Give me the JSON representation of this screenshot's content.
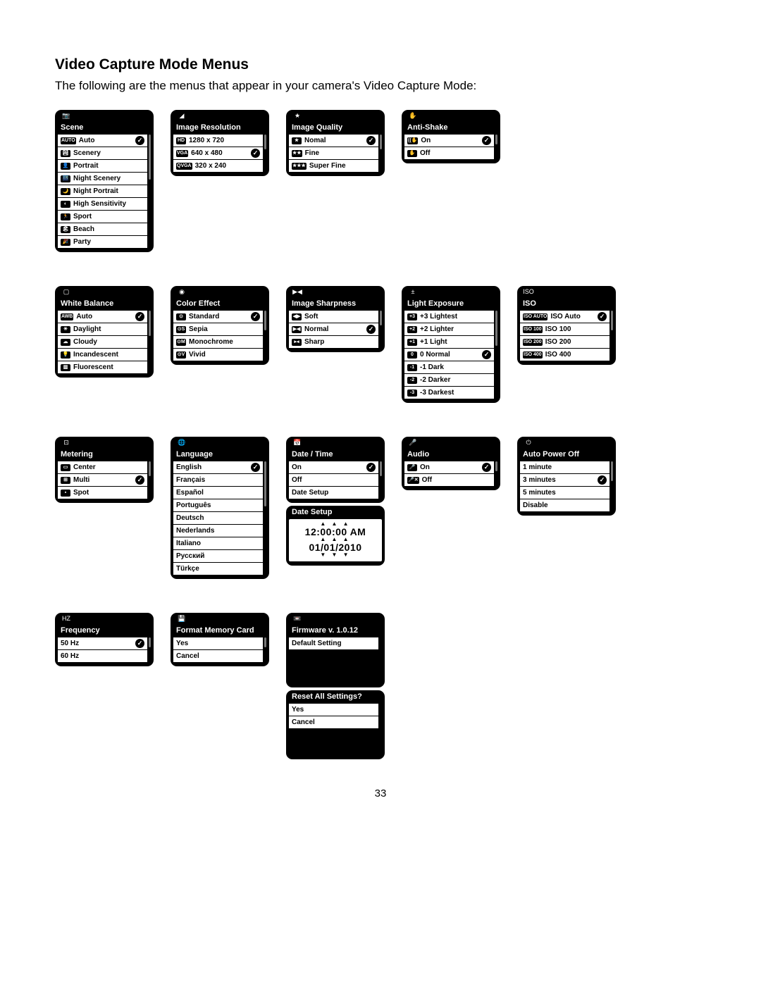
{
  "page": {
    "title": "Video Capture Mode Menus",
    "intro": "The following are the menus that appear in your camera's Video Capture Mode:",
    "page_number": "33"
  },
  "menus": {
    "scene": {
      "tab_icon": "📷",
      "title": "Scene",
      "items": [
        {
          "icon_text": "AUTO",
          "label": "Auto",
          "selected": true
        },
        {
          "icon_text": "🏞",
          "label": "Scenery"
        },
        {
          "icon_text": "👤",
          "label": "Portrait"
        },
        {
          "icon_text": "🌃",
          "label": "Night Scenery"
        },
        {
          "icon_text": "🌙",
          "label": "Night Portrait"
        },
        {
          "icon_text": "◐",
          "label": "High Sensitivity"
        },
        {
          "icon_text": "🏃",
          "label": "Sport"
        },
        {
          "icon_text": "🏖",
          "label": "Beach"
        },
        {
          "icon_text": "🎉",
          "label": "Party"
        }
      ]
    },
    "image_resolution": {
      "tab_icon": "◢",
      "title": "Image Resolution",
      "items": [
        {
          "icon_text": "HD",
          "label": "1280 x 720"
        },
        {
          "icon_text": "VGA",
          "label": "640 x 480",
          "selected": true
        },
        {
          "icon_text": "QVGA",
          "label": "320 x 240"
        }
      ]
    },
    "image_quality": {
      "tab_icon": "★",
      "title": "Image Quality",
      "items": [
        {
          "icon_text": "★",
          "label": "Nomal",
          "selected": true
        },
        {
          "icon_text": "★★",
          "label": "Fine"
        },
        {
          "icon_text": "★★★",
          "label": "Super Fine"
        }
      ]
    },
    "anti_shake": {
      "tab_icon": "✋",
      "title": "Anti-Shake",
      "items": [
        {
          "icon_text": "((✋",
          "label": "On",
          "selected": true
        },
        {
          "icon_text": "✋",
          "label": "Off"
        }
      ]
    },
    "white_balance": {
      "tab_icon": "▢",
      "title": "White Balance",
      "items": [
        {
          "icon_text": "AWB",
          "label": "Auto",
          "selected": true
        },
        {
          "icon_text": "☀",
          "label": "Daylight"
        },
        {
          "icon_text": "☁",
          "label": "Cloudy"
        },
        {
          "icon_text": "💡",
          "label": "Incandescent"
        },
        {
          "icon_text": "▥",
          "label": "Fluorescent"
        }
      ]
    },
    "color_effect": {
      "tab_icon": "◉",
      "title": "Color Effect",
      "items": [
        {
          "icon_text": "⊙",
          "label": "Standard",
          "selected": true
        },
        {
          "icon_text": "⊙S",
          "label": "Sepia"
        },
        {
          "icon_text": "⊙M",
          "label": "Monochrome"
        },
        {
          "icon_text": "⊙V",
          "label": "Vivid"
        }
      ]
    },
    "image_sharpness": {
      "tab_icon": "▶◀",
      "title": "Image Sharpness",
      "items": [
        {
          "icon_text": "◀▶",
          "label": "Soft"
        },
        {
          "icon_text": "▶◀",
          "label": "Normal",
          "selected": true
        },
        {
          "icon_text": "▸◂",
          "label": "Sharp"
        }
      ]
    },
    "light_exposure": {
      "tab_icon": "±",
      "title": "Light Exposure",
      "items": [
        {
          "icon_text": "+3",
          "label": "+3 Lightest"
        },
        {
          "icon_text": "+2",
          "label": "+2 Lighter"
        },
        {
          "icon_text": "+1",
          "label": "+1 Light"
        },
        {
          "icon_text": "0",
          "label": "0 Normal",
          "selected": true
        },
        {
          "icon_text": "-1",
          "label": "-1 Dark"
        },
        {
          "icon_text": "-2",
          "label": "-2 Darker"
        },
        {
          "icon_text": "-3",
          "label": "-3 Darkest"
        }
      ]
    },
    "iso": {
      "tab_icon": "ISO",
      "title": "ISO",
      "items": [
        {
          "icon_text": "ISO\nAUTO",
          "label": "ISO Auto",
          "selected": true
        },
        {
          "icon_text": "ISO\n100",
          "label": "ISO 100"
        },
        {
          "icon_text": "ISO\n200",
          "label": "ISO 200"
        },
        {
          "icon_text": "ISO\n400",
          "label": "ISO 400"
        }
      ]
    },
    "metering": {
      "tab_icon": "⊡",
      "title": "Metering",
      "items": [
        {
          "icon_text": "▭",
          "label": "Center"
        },
        {
          "icon_text": "⊞",
          "label": "Multi",
          "selected": true
        },
        {
          "icon_text": "▪",
          "label": "Spot"
        }
      ]
    },
    "language": {
      "tab_icon": "🌐",
      "title": "Language",
      "items": [
        {
          "label": "English",
          "selected": true
        },
        {
          "label": "Français"
        },
        {
          "label": "Español"
        },
        {
          "label": "Português"
        },
        {
          "label": "Deutsch"
        },
        {
          "label": "Nederlands"
        },
        {
          "label": "Italiano"
        },
        {
          "label": "Русский"
        },
        {
          "label": "Türkçe"
        }
      ]
    },
    "date_time": {
      "tab_icon": "📅",
      "title": "Date / Time",
      "items": [
        {
          "label": "On",
          "selected": true
        },
        {
          "label": "Off"
        },
        {
          "label": "Date Setup"
        }
      ]
    },
    "date_setup": {
      "title": "Date Setup",
      "time": "12:00:00 AM",
      "date": "01/01/2010"
    },
    "audio": {
      "tab_icon": "🎤",
      "title": "Audio",
      "items": [
        {
          "icon_text": "🎤",
          "label": "On",
          "selected": true
        },
        {
          "icon_text": "🎤✕",
          "label": "Off"
        }
      ]
    },
    "auto_power_off": {
      "tab_icon": "⏻",
      "title": "Auto Power Off",
      "items": [
        {
          "label": "1 minute"
        },
        {
          "label": "3 minutes",
          "selected": true
        },
        {
          "label": "5 minutes"
        },
        {
          "label": "Disable"
        }
      ]
    },
    "frequency": {
      "tab_icon": "HZ",
      "title": "Frequency",
      "items": [
        {
          "label": "50 Hz",
          "selected": true
        },
        {
          "label": "60 Hz"
        }
      ]
    },
    "format_memory_card": {
      "tab_icon": "💾",
      "title": "Format Memory Card",
      "items": [
        {
          "label": "Yes"
        },
        {
          "label": "Cancel"
        }
      ]
    },
    "firmware": {
      "tab_icon": "📼",
      "title": "Firmware v. 1.0.12",
      "items": [
        {
          "label": "Default Setting"
        }
      ]
    },
    "reset_all": {
      "title": "Reset All Settings?",
      "items": [
        {
          "label": "Yes"
        },
        {
          "label": "Cancel"
        }
      ]
    }
  }
}
